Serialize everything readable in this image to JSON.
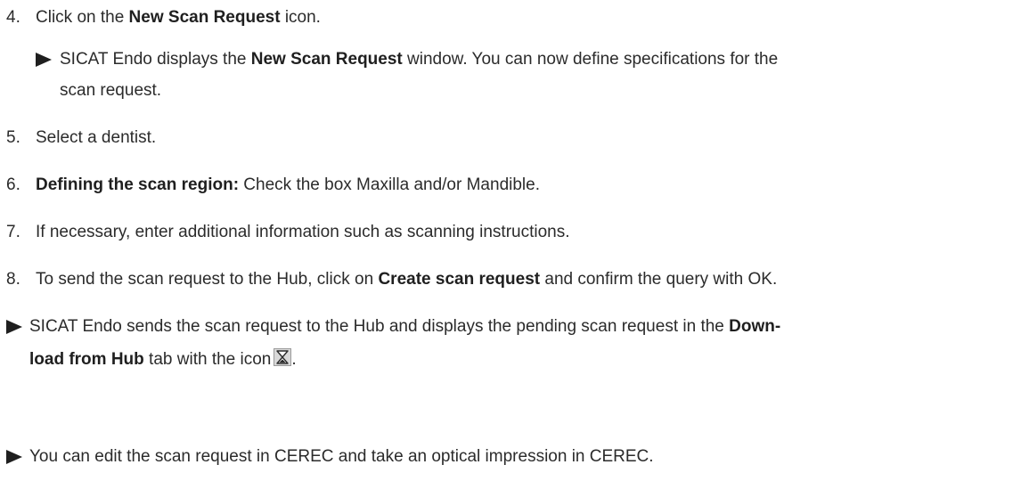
{
  "steps": [
    {
      "num": "4.",
      "pre": "Click on the ",
      "bold": "New Scan Request",
      "post": " icon."
    },
    {
      "num": "5.",
      "text": "Select a dentist."
    },
    {
      "num": "6.",
      "bold": "Defining the scan region:",
      "post": " Check the box Maxilla and/or Mandible."
    },
    {
      "num": "7.",
      "text": "If necessary, enter additional information such as scanning instructions."
    },
    {
      "num": "8.",
      "pre": "To send the scan request to the Hub, click on ",
      "bold": "Create scan request",
      "post": " and confirm the query with OK."
    }
  ],
  "step4_result": {
    "pre": "SICAT Endo displays the ",
    "bold": "New Scan Request",
    "post": " window. You can now define specifications for the",
    "line2": "scan request."
  },
  "result1": {
    "pre": "SICAT Endo sends the scan request to the Hub and displays the pending scan request in the ",
    "bold1": "Down-",
    "bold2": "load from Hub",
    "post": " tab with the icon",
    "end": "."
  },
  "result2": {
    "text": "You can edit the scan request in CEREC and take an optical impression in CEREC."
  },
  "icons": {
    "result_marker": "right-triangle-arrow",
    "pending_icon": "hourglass-icon"
  },
  "colors": {
    "text": "#2b2b2b",
    "bold": "#1f1f1f"
  }
}
